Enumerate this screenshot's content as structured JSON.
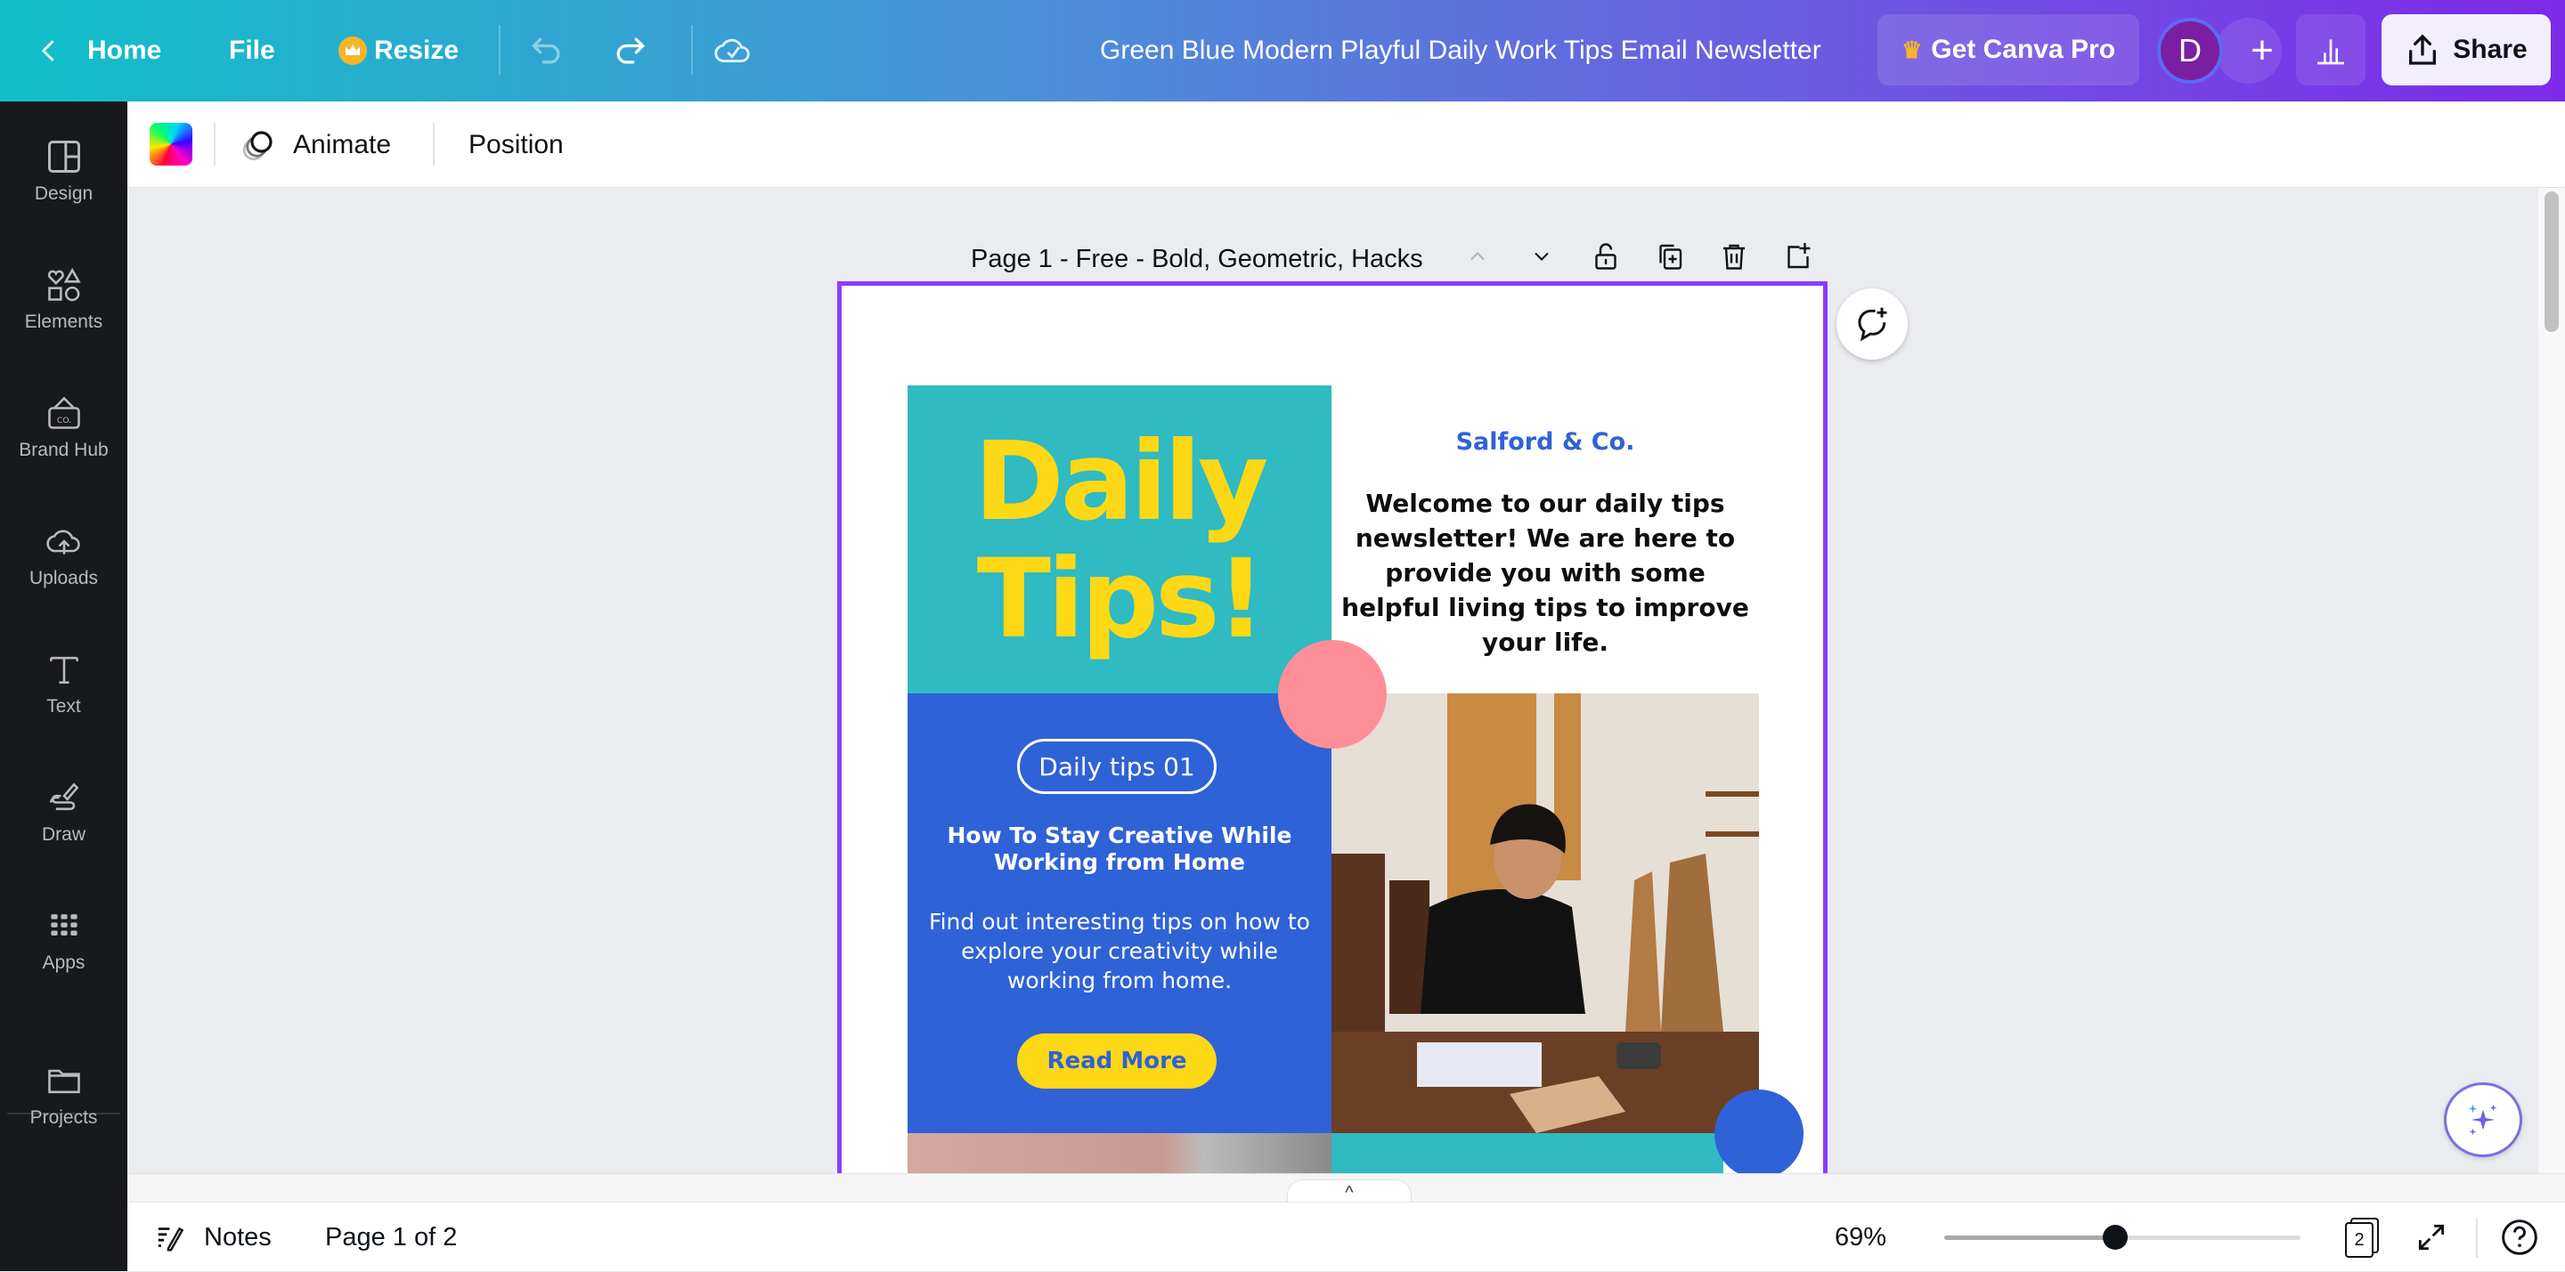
{
  "topbar": {
    "home_label": "Home",
    "file_label": "File",
    "resize_label": "Resize",
    "document_title": "Green Blue Modern Playful Daily Work Tips Email Newsletter",
    "get_pro_label": "Get Canva Pro",
    "avatar_initial": "D",
    "share_label": "Share"
  },
  "sidebar": {
    "items": [
      {
        "label": "Design",
        "icon": "layout-icon"
      },
      {
        "label": "Elements",
        "icon": "shapes-icon"
      },
      {
        "label": "Brand Hub",
        "icon": "brand-icon"
      },
      {
        "label": "Uploads",
        "icon": "cloud-upload-icon"
      },
      {
        "label": "Text",
        "icon": "text-icon"
      },
      {
        "label": "Draw",
        "icon": "draw-icon"
      },
      {
        "label": "Apps",
        "icon": "apps-grid-icon"
      },
      {
        "label": "Projects",
        "icon": "folder-icon"
      }
    ]
  },
  "toolbar": {
    "animate_label": "Animate",
    "position_label": "Position"
  },
  "canvas": {
    "page_label": "Page 1 - Free - Bold, Geometric, Hacks",
    "design": {
      "headline_line1": "Daily",
      "headline_line2": "Tips!",
      "company": "Salford & Co.",
      "welcome_text": "Welcome to our daily tips newsletter! We are here to provide you with some helpful living tips to improve your life.",
      "pill_label": "Daily tips 01",
      "tip_heading": "How To Stay Creative While Working from Home",
      "tip_body": "Find out interesting tips on how to explore your creativity while working from home.",
      "read_more_label": "Read More",
      "colors": {
        "teal": "#30bac2",
        "blue": "#2f62d6",
        "yellow": "#fdd816",
        "pink": "#fe8f98"
      }
    }
  },
  "statusbar": {
    "notes_label": "Notes",
    "page_indicator": "Page 1 of 2",
    "zoom_percent": "69%",
    "zoom_slider_fraction": 0.48,
    "page_count": "2"
  },
  "colors": {
    "selection_border": "#8b3dff",
    "sidebar_bg": "#18191b"
  }
}
